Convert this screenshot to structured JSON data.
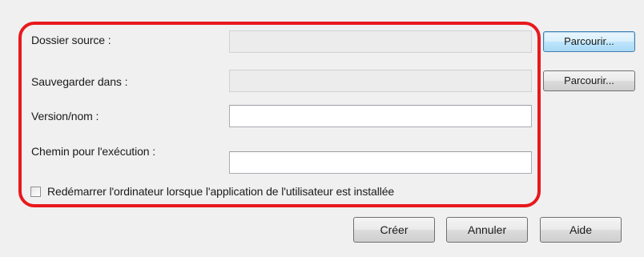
{
  "form": {
    "source_folder": {
      "label": "Dossier source :",
      "value": "",
      "browse_label": "Parcourir..."
    },
    "save_in": {
      "label": "Sauvegarder dans :",
      "value": "",
      "browse_label": "Parcourir..."
    },
    "version_name": {
      "label": "Version/nom :",
      "value": ""
    },
    "execution_path": {
      "label": "Chemin pour l'exécution :",
      "value": ""
    },
    "restart_option": {
      "label": "Redémarrer l'ordinateur lorsque l'application de l'utilisateur est installée",
      "checked": false
    }
  },
  "buttons": {
    "create": "Créer",
    "cancel": "Annuler",
    "help": "Aide"
  },
  "colors": {
    "highlight_frame": "#e8191e",
    "dialog_background": "#f0f0f0"
  }
}
